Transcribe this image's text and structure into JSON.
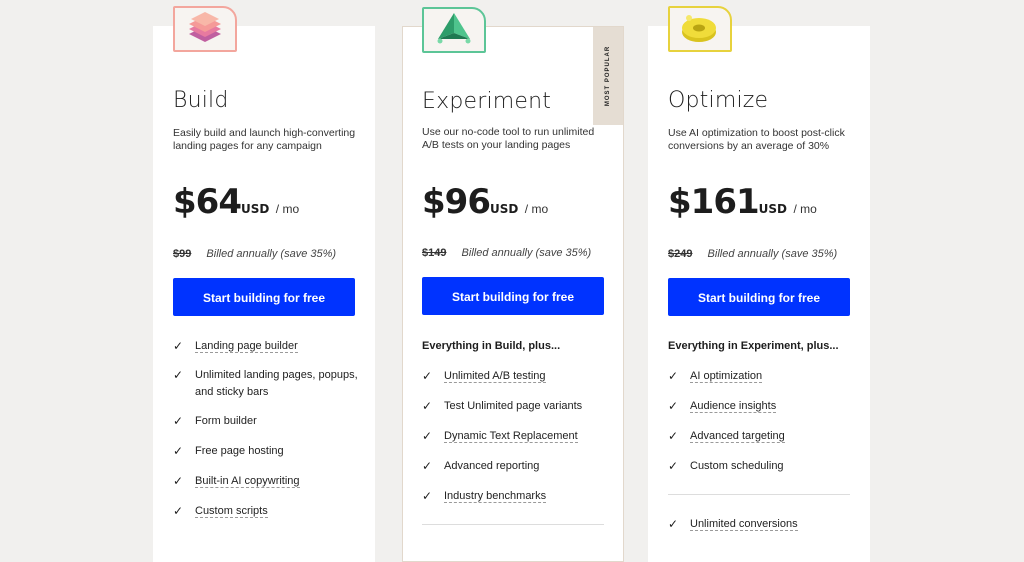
{
  "colors": {
    "accent": "#0033ff",
    "build": "#f08a80",
    "experiment": "#34b27a",
    "optimize": "#e6cf2e"
  },
  "plans": [
    {
      "name": "Build",
      "icon": "stacked-layers-icon",
      "description": "Easily build and launch high-converting landing pages for any campaign",
      "price": "$64",
      "currency": "USD",
      "period": "/ mo",
      "original_price": "$99",
      "billing": "Billed annually (save 35%)",
      "cta": "Start building for free",
      "intro": "",
      "features": [
        "Landing page builder",
        "Unlimited landing pages, popups, and sticky bars",
        "Form builder",
        "Free page hosting",
        "Built-in AI copywriting",
        "Custom scripts"
      ]
    },
    {
      "name": "Experiment",
      "icon": "pyramid-icon",
      "badge": "MOST POPULAR",
      "description": "Use our no-code tool to run unlimited A/B tests on your landing pages",
      "price": "$96",
      "currency": "USD",
      "period": "/ mo",
      "original_price": "$149",
      "billing": "Billed annually (save 35%)",
      "cta": "Start building for free",
      "intro": "Everything in Build, plus...",
      "features": [
        "Unlimited A/B testing",
        "Test Unlimited page variants",
        "Dynamic Text Replacement",
        "Advanced reporting",
        "Industry benchmarks"
      ]
    },
    {
      "name": "Optimize",
      "icon": "donut-shape-icon",
      "description": "Use AI optimization to boost post-click conversions by an average of 30%",
      "price": "$161",
      "currency": "USD",
      "period": "/ mo",
      "original_price": "$249",
      "billing": "Billed annually (save 35%)",
      "cta": "Start building for free",
      "intro": "Everything in Experiment, plus...",
      "features": [
        "AI optimization",
        "Audience insights",
        "Advanced targeting",
        "Custom scheduling"
      ],
      "extra_features": [
        "Unlimited conversions"
      ]
    }
  ]
}
